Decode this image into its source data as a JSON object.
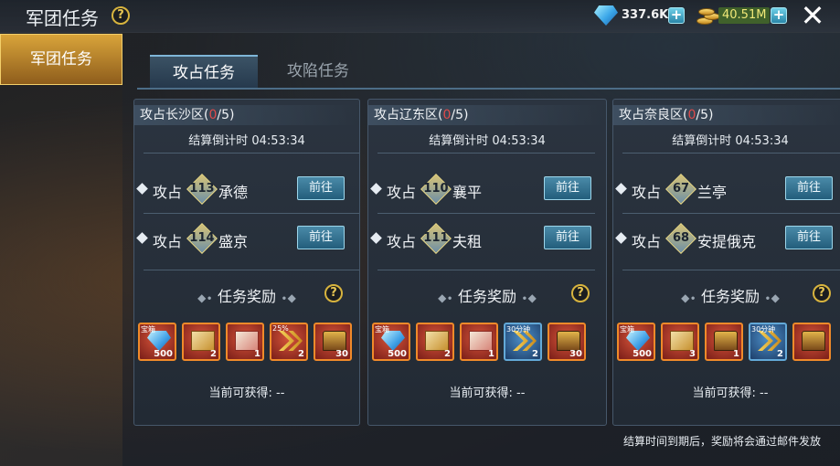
{
  "header": {
    "title": "军团任务",
    "gems": "337.6K",
    "gold": "40.51M"
  },
  "sidebar": {
    "tab_label": "军团任务"
  },
  "tabs": [
    {
      "label": "攻占任务",
      "active": true
    },
    {
      "label": "攻陷任务",
      "active": false
    }
  ],
  "cards": [
    {
      "title": "攻占长沙区",
      "progress_current": "0",
      "progress_total": "/5",
      "countdown": "结算倒计时 04:53:34",
      "tasks": [
        {
          "action": "攻占",
          "level": "113",
          "city": "承德",
          "button": "前往"
        },
        {
          "action": "攻占",
          "level": "114",
          "city": "盛京",
          "button": "前往"
        }
      ],
      "reward_title": "任务奖励",
      "rewards": [
        {
          "art": "gem",
          "tag": "宝箱",
          "count": "500",
          "frame": "orange"
        },
        {
          "art": "book",
          "tag": "",
          "count": "2",
          "frame": "orange"
        },
        {
          "art": "scroll",
          "tag": "",
          "count": "1",
          "frame": "orange"
        },
        {
          "art": "arrow",
          "tag": "25%",
          "count": "2",
          "frame": "orange"
        },
        {
          "art": "chest",
          "tag": "",
          "count": "30",
          "frame": "orange"
        }
      ],
      "current": "当前可获得: --"
    },
    {
      "title": "攻占辽东区",
      "progress_current": "0",
      "progress_total": "/5",
      "countdown": "结算倒计时 04:53:34",
      "tasks": [
        {
          "action": "攻占",
          "level": "110",
          "city": "襄平",
          "button": "前往"
        },
        {
          "action": "攻占",
          "level": "111",
          "city": "夫租",
          "button": "前往"
        }
      ],
      "reward_title": "任务奖励",
      "rewards": [
        {
          "art": "gem",
          "tag": "宝箱",
          "count": "500",
          "frame": "orange"
        },
        {
          "art": "book",
          "tag": "",
          "count": "2",
          "frame": "orange"
        },
        {
          "art": "scroll",
          "tag": "",
          "count": "1",
          "frame": "orange"
        },
        {
          "art": "arrow",
          "tag": "30分钟",
          "count": "2",
          "frame": "blue"
        },
        {
          "art": "chest",
          "tag": "",
          "count": "30",
          "frame": "orange"
        }
      ],
      "current": "当前可获得: --"
    },
    {
      "title": "攻占奈良区",
      "progress_current": "0",
      "progress_total": "/5",
      "countdown": "结算倒计时 04:53:34",
      "tasks": [
        {
          "action": "攻占",
          "level": "67",
          "city": "兰亭",
          "button": "前往"
        },
        {
          "action": "攻占",
          "level": "68",
          "city": "安提俄克",
          "button": "前往"
        }
      ],
      "reward_title": "任务奖励",
      "rewards": [
        {
          "art": "gem",
          "tag": "宝箱",
          "count": "500",
          "frame": "orange"
        },
        {
          "art": "book",
          "tag": "",
          "count": "3",
          "frame": "orange"
        },
        {
          "art": "chest",
          "tag": "",
          "count": "1",
          "frame": "orange"
        },
        {
          "art": "arrow",
          "tag": "30分钟",
          "count": "2",
          "frame": "blue"
        },
        {
          "art": "chest",
          "tag": "",
          "count": "",
          "frame": "orange"
        }
      ],
      "current": "当前可获得: --"
    }
  ],
  "footer_note": "结算时间到期后，奖励将会通过邮件发放",
  "icons": {
    "help": "?",
    "plus": "+",
    "close": "✕"
  },
  "colors": {
    "accent_gold": "#d9a43a",
    "progress_red": "#e04a4a",
    "button_teal": "#235e7c"
  }
}
